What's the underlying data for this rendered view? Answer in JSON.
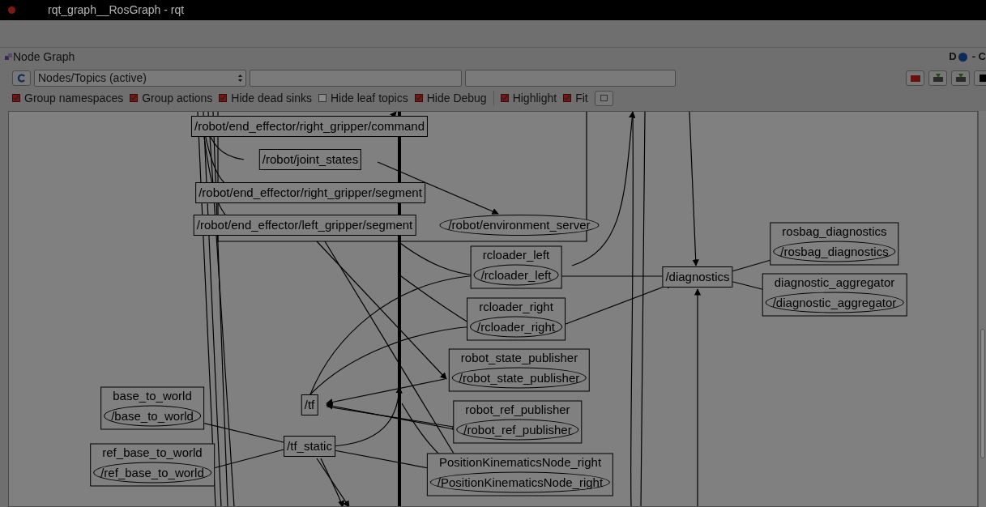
{
  "window": {
    "title": "rqt_graph__RosGraph - rqt"
  },
  "plugin": {
    "title": "Node Graph",
    "header_left": "D",
    "header_right": "- C"
  },
  "toolbar": {
    "graph_type": "Nodes/Topics (active)"
  },
  "options": [
    {
      "label": "Group namespaces",
      "checked": true
    },
    {
      "label": "Group actions",
      "checked": true
    },
    {
      "label": "Hide dead sinks",
      "checked": true
    },
    {
      "label": "Hide leaf topics",
      "checked": false
    },
    {
      "label": "Hide Debug",
      "checked": true
    }
  ],
  "view_options": [
    {
      "label": "Highlight",
      "checked": true
    },
    {
      "label": "Fit",
      "checked": true
    }
  ],
  "graph": {
    "topics": [
      {
        "label": "/robot/end_effector/right_gripper/command"
      },
      {
        "label": "/robot/joint_states"
      },
      {
        "label": "/robot/end_effector/right_gripper/segment"
      },
      {
        "label": "/robot/end_effector/left_gripper/segment"
      },
      {
        "label": "/diagnostics"
      },
      {
        "label": "/tf"
      },
      {
        "label": "/tf_static"
      }
    ],
    "standalone_nodes": [
      {
        "name": "/robot/environment_server"
      }
    ],
    "nodes": [
      {
        "group": "rcloader_left",
        "name": "/rcloader_left"
      },
      {
        "group": "rcloader_right",
        "name": "/rcloader_right"
      },
      {
        "group": "robot_state_publisher",
        "name": "/robot_state_publisher"
      },
      {
        "group": "robot_ref_publisher",
        "name": "/robot_ref_publisher"
      },
      {
        "group": "PositionKinematicsNode_right",
        "name": "/PositionKinematicsNode_right"
      },
      {
        "group": "rosbag_diagnostics",
        "name": "/rosbag_diagnostics"
      },
      {
        "group": "diagnostic_aggregator",
        "name": "/diagnostic_aggregator"
      },
      {
        "group": "base_to_world",
        "name": "/base_to_world"
      },
      {
        "group": "ref_base_to_world",
        "name": "/ref_base_to_world"
      }
    ]
  }
}
